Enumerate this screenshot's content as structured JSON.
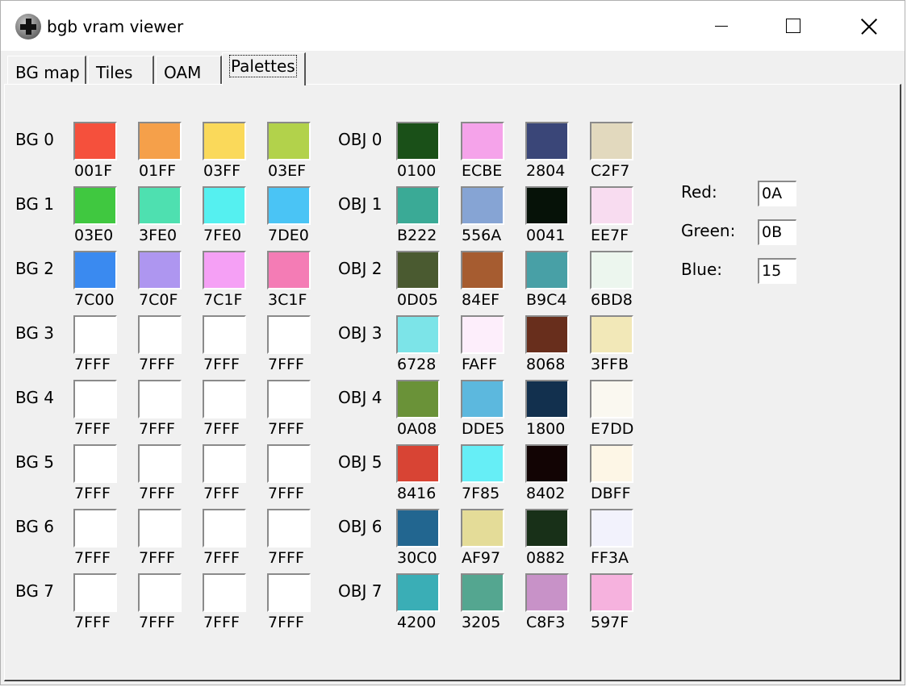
{
  "window": {
    "title": "bgb vram viewer"
  },
  "tabs": [
    {
      "label": "BG map",
      "active": false
    },
    {
      "label": "Tiles",
      "active": false
    },
    {
      "label": "OAM",
      "active": false
    },
    {
      "label": "Palettes",
      "active": true
    }
  ],
  "bg_palettes": [
    {
      "label": "BG 0",
      "colors": [
        {
          "hex": "001F",
          "rgb": "#f5503c"
        },
        {
          "hex": "01FF",
          "rgb": "#f5a04a"
        },
        {
          "hex": "03FF",
          "rgb": "#fad95a"
        },
        {
          "hex": "03EF",
          "rgb": "#b2d24b"
        }
      ]
    },
    {
      "label": "BG 1",
      "colors": [
        {
          "hex": "03E0",
          "rgb": "#40c840"
        },
        {
          "hex": "3FE0",
          "rgb": "#4ee0b0"
        },
        {
          "hex": "7FE0",
          "rgb": "#55f0f0"
        },
        {
          "hex": "7DE0",
          "rgb": "#4ac4f5"
        }
      ]
    },
    {
      "label": "BG 2",
      "colors": [
        {
          "hex": "7C00",
          "rgb": "#3a8af0"
        },
        {
          "hex": "7C0F",
          "rgb": "#ae96f0"
        },
        {
          "hex": "7C1F",
          "rgb": "#f5a0f5"
        },
        {
          "hex": "3C1F",
          "rgb": "#f47cb5"
        }
      ]
    },
    {
      "label": "BG 3",
      "colors": [
        {
          "hex": "7FFF",
          "rgb": "#ffffff"
        },
        {
          "hex": "7FFF",
          "rgb": "#ffffff"
        },
        {
          "hex": "7FFF",
          "rgb": "#ffffff"
        },
        {
          "hex": "7FFF",
          "rgb": "#ffffff"
        }
      ]
    },
    {
      "label": "BG 4",
      "colors": [
        {
          "hex": "7FFF",
          "rgb": "#ffffff"
        },
        {
          "hex": "7FFF",
          "rgb": "#ffffff"
        },
        {
          "hex": "7FFF",
          "rgb": "#ffffff"
        },
        {
          "hex": "7FFF",
          "rgb": "#ffffff"
        }
      ]
    },
    {
      "label": "BG 5",
      "colors": [
        {
          "hex": "7FFF",
          "rgb": "#ffffff"
        },
        {
          "hex": "7FFF",
          "rgb": "#ffffff"
        },
        {
          "hex": "7FFF",
          "rgb": "#ffffff"
        },
        {
          "hex": "7FFF",
          "rgb": "#ffffff"
        }
      ]
    },
    {
      "label": "BG 6",
      "colors": [
        {
          "hex": "7FFF",
          "rgb": "#ffffff"
        },
        {
          "hex": "7FFF",
          "rgb": "#ffffff"
        },
        {
          "hex": "7FFF",
          "rgb": "#ffffff"
        },
        {
          "hex": "7FFF",
          "rgb": "#ffffff"
        }
      ]
    },
    {
      "label": "BG 7",
      "colors": [
        {
          "hex": "7FFF",
          "rgb": "#ffffff"
        },
        {
          "hex": "7FFF",
          "rgb": "#ffffff"
        },
        {
          "hex": "7FFF",
          "rgb": "#ffffff"
        },
        {
          "hex": "7FFF",
          "rgb": "#ffffff"
        }
      ]
    }
  ],
  "obj_palettes": [
    {
      "label": "OBJ 0",
      "colors": [
        {
          "hex": "0100",
          "rgb": "#1a5018"
        },
        {
          "hex": "ECBE",
          "rgb": "#f5a3ea"
        },
        {
          "hex": "2804",
          "rgb": "#3a4678"
        },
        {
          "hex": "C2F7",
          "rgb": "#e2d9be"
        }
      ]
    },
    {
      "label": "OBJ 1",
      "colors": [
        {
          "hex": "B222",
          "rgb": "#3aaa96"
        },
        {
          "hex": "556A",
          "rgb": "#86a4d4"
        },
        {
          "hex": "0041",
          "rgb": "#061208"
        },
        {
          "hex": "EE7F",
          "rgb": "#f8dcf0"
        }
      ]
    },
    {
      "label": "OBJ 2",
      "colors": [
        {
          "hex": "0D05",
          "rgb": "#4a5a30"
        },
        {
          "hex": "84EF",
          "rgb": "#a65c30"
        },
        {
          "hex": "B9C4",
          "rgb": "#48a0a6"
        },
        {
          "hex": "6BD8",
          "rgb": "#ecf6ee"
        }
      ]
    },
    {
      "label": "OBJ 3",
      "colors": [
        {
          "hex": "6728",
          "rgb": "#7ce4e8"
        },
        {
          "hex": "FAFF",
          "rgb": "#fdeefb"
        },
        {
          "hex": "8068",
          "rgb": "#682e1c"
        },
        {
          "hex": "3FFB",
          "rgb": "#f2e8b8"
        }
      ]
    },
    {
      "label": "OBJ 4",
      "colors": [
        {
          "hex": "0A08",
          "rgb": "#6a9238"
        },
        {
          "hex": "DDE5",
          "rgb": "#5cb8de"
        },
        {
          "hex": "1800",
          "rgb": "#12304e"
        },
        {
          "hex": "E7DD",
          "rgb": "#faf8f0"
        }
      ]
    },
    {
      "label": "OBJ 5",
      "colors": [
        {
          "hex": "8416",
          "rgb": "#d84434"
        },
        {
          "hex": "7F85",
          "rgb": "#66eef6"
        },
        {
          "hex": "8402",
          "rgb": "#120404"
        },
        {
          "hex": "DBFF",
          "rgb": "#fdf6e6"
        }
      ]
    },
    {
      "label": "OBJ 6",
      "colors": [
        {
          "hex": "30C0",
          "rgb": "#226690"
        },
        {
          "hex": "AF97",
          "rgb": "#e4dc98"
        },
        {
          "hex": "0882",
          "rgb": "#183018"
        },
        {
          "hex": "FF3A",
          "rgb": "#f2f2fc"
        }
      ]
    },
    {
      "label": "OBJ 7",
      "colors": [
        {
          "hex": "4200",
          "rgb": "#3aaeb6"
        },
        {
          "hex": "3205",
          "rgb": "#54a690"
        },
        {
          "hex": "C8F3",
          "rgb": "#c892c8"
        },
        {
          "hex": "597F",
          "rgb": "#f6b2de"
        }
      ]
    }
  ],
  "inspector": {
    "red_label": "Red:",
    "red_value": "0A",
    "green_label": "Green:",
    "green_value": "0B",
    "blue_label": "Blue:",
    "blue_value": "15"
  }
}
